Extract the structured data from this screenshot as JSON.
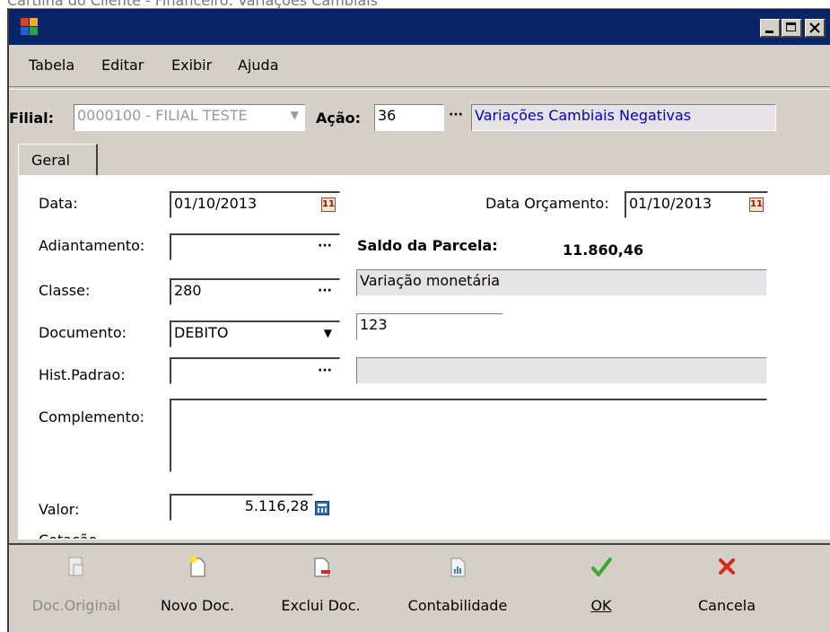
{
  "doc_caption": "Cartilha do Cliente - Financeiro: Variações Cambiais",
  "menu": [
    "Tabela",
    "Editar",
    "Exibir",
    "Ajuda"
  ],
  "header": {
    "filial_label": "Filial:",
    "filial_value": "0000100 - FILIAL TESTE",
    "acao_label": "Ação:",
    "acao_value": "36",
    "acao_desc": "Variações Cambiais Negativas"
  },
  "tab_label": "Geral",
  "form": {
    "data_label": "Data:",
    "data_value": "01/10/2013",
    "data_orc_label": "Data Orçamento:",
    "data_orc_value": "01/10/2013",
    "adiantamento_label": "Adiantamento:",
    "adiantamento_value": "",
    "saldo_label": "Saldo da Parcela:",
    "saldo_value": "11.860,46",
    "classe_label": "Classe:",
    "classe_value": "280",
    "classe_desc": "Variação monetária",
    "documento_label": "Documento:",
    "documento_value": "DEBITO",
    "documento_num": "123",
    "hist_label": "Hist.Padrao:",
    "hist_value": "",
    "hist_desc": "",
    "complemento_label": "Complemento:",
    "complemento_value": "",
    "valor_label": "Valor:",
    "valor_value": "5.116,28",
    "partial_label": "Cotação"
  },
  "toolbar": {
    "doc_original": "Doc.Original",
    "novo_doc": "Novo Doc.",
    "exclui_doc": "Exclui Doc.",
    "contabilidade": "Contabilidade",
    "ok": "OK",
    "cancela": "Cancela"
  },
  "colors": {
    "titlebar": "#0a246a",
    "window_bg": "#d4d0c8",
    "accent_blue": "#0000c0",
    "ok_green": "#3aa832",
    "cancel_red": "#d42b1e"
  }
}
